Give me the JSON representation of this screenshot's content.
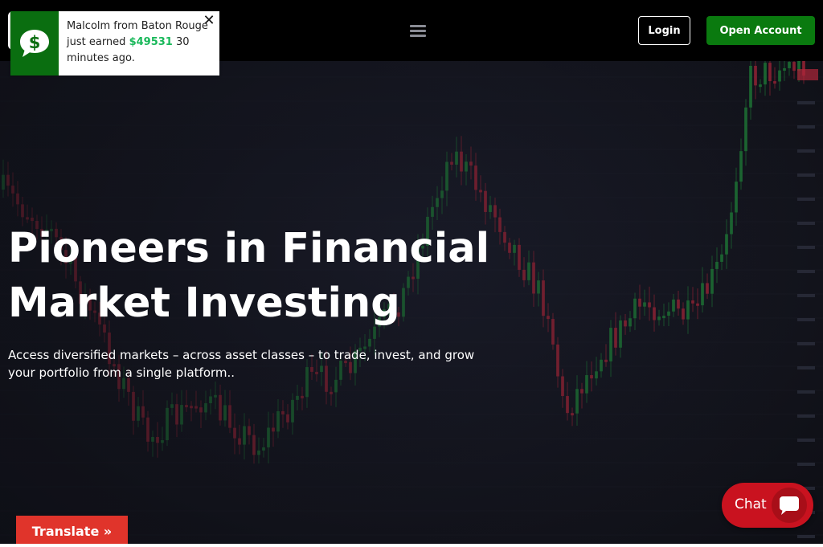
{
  "header": {
    "menu_icon": "hamburger-menu-icon",
    "login_label": "Login",
    "open_account_label": "Open Account"
  },
  "notification": {
    "icon": "dollar-speech-bubble-icon",
    "text_before": "Malcolm from Baton Rouge just earned ",
    "amount": "$49531",
    "text_after": " 30 minutes ago.",
    "close_label": "✕",
    "amount_color": "#19b85a"
  },
  "hero": {
    "title": "Pioneers in Financial Market Investing",
    "subtitle": "Access diversified markets – across asset classes – to trade, invest, and grow your portfolio from a single platform.."
  },
  "translate": {
    "label": "Translate »"
  },
  "chat": {
    "label": "Chat",
    "icon": "chat-bubble-icon"
  },
  "colors": {
    "brand_green": "#0a7a0f",
    "notification_green": "#0a6e10",
    "translate_red": "#e0342b",
    "chat_red": "#c9121f",
    "hero_background": "#14151d"
  }
}
